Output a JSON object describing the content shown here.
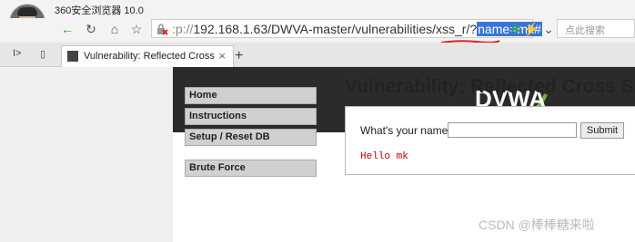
{
  "app": {
    "title": "360安全浏览器 10.0"
  },
  "address": {
    "url_dim": ":p://",
    "url_main": "192.168.1.63/DWVA-master/vulnerabilities/xss_r/?",
    "url_selected": "name=mk#"
  },
  "search": {
    "placeholder": "点此搜索"
  },
  "tab": {
    "title": "Vulnerability: Reflected Cross"
  },
  "header": {
    "logo": "DVWA"
  },
  "menu": {
    "items": [
      "Home",
      "Instructions",
      "Setup / Reset DB"
    ],
    "items2": [
      "Brute Force"
    ]
  },
  "page": {
    "title": "Vulnerability: Reflected Cross S",
    "question": "What's your name?",
    "submit": "Submit",
    "hello": "Hello mk"
  },
  "watermark": "CSDN @棒棒糖来啦"
}
